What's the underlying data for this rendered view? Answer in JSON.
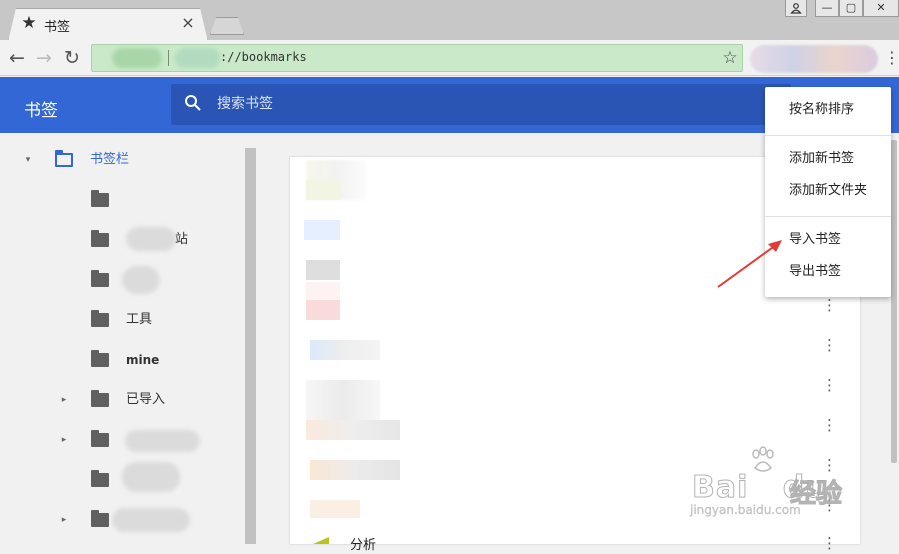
{
  "window": {
    "tab_title": "书签",
    "tab_icon": "star-icon",
    "tab_close": "×",
    "user_icon": "⚲",
    "min_icon": "—",
    "max_icon": "▢",
    "close_icon": "✕"
  },
  "toolbar": {
    "back": "←",
    "forward": "→",
    "reload": "↻",
    "url_text": "://bookmarks",
    "bookmark_star": "☆",
    "menu": "⋮"
  },
  "app": {
    "title": "书签",
    "search_placeholder": "搜索书签",
    "accent": "#3367d6"
  },
  "sidebar": {
    "items": [
      {
        "label": "书签栏",
        "expanded": true
      },
      {
        "label": ""
      },
      {
        "label": "站"
      },
      {
        "label": ""
      },
      {
        "label": "工具"
      },
      {
        "label": "mine"
      },
      {
        "label": "已导入"
      },
      {
        "label": ""
      },
      {
        "label": ""
      },
      {
        "label": ""
      }
    ],
    "arrow_open": "▾",
    "arrow_closed": "▸"
  },
  "main": {
    "row_menu": "⋮",
    "bottom_label": "分析"
  },
  "menu": {
    "sort": "按名称排序",
    "add_bookmark": "添加新书签",
    "add_folder": "添加新文件夹",
    "import": "导入书签",
    "export": "导出书签"
  },
  "watermark": {
    "brand": "Bai",
    "brand2": "du",
    "cn": "经验",
    "sub": "jingyan.baidu.com"
  }
}
